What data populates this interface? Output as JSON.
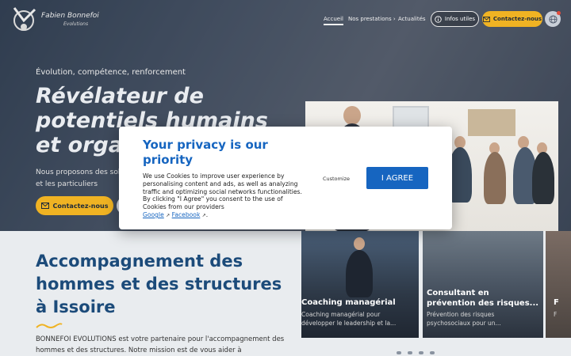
{
  "nav": {
    "logo_name": "Fabien Bonnefoi",
    "logo_sub": "Evolutions",
    "links": [
      "Accueil",
      "Nos prestations",
      "Actualités"
    ],
    "nos_prestations_chevron": "›",
    "info_button": "Infos utiles",
    "contact_button": "Contactez-nous",
    "globe_icon": "globe-icon"
  },
  "hero": {
    "eyebrow": "Évolution, compétence, renforcement",
    "title": "Révélateur de potentiels humains et organisationnels",
    "description": "Nous proposons des solutions d'accompagnement aux entreprises et les particuliers",
    "contact_button": "Contactez-nous"
  },
  "lower": {
    "title": "Accompagnement des hommes et des structures à Issoire",
    "text": "BONNEFOI EVOLUTIONS est votre partenaire pour l'accompagnement des hommes et des structures. Notre mission est de vous aider à"
  },
  "cards": [
    {
      "title": "Coaching managérial",
      "sub1": "Coaching managérial pour",
      "sub2": "développer le leadership et la..."
    },
    {
      "title": "Consultant en",
      "title2": "prévention des risques...",
      "sub1": "Prévention des risques",
      "sub2": "psychosociaux pour un..."
    },
    {
      "title": "F",
      "sub1": "F",
      "sub2": ""
    }
  ],
  "cookie_modal": {
    "title": "Your privacy is our priority",
    "body": "We use Cookies to improve user experience by personalising content and ads, as well as analyzing traffic and optimizing social networks functionalities. By clicking \"I Agree\" you consent to the use of Cookies from our providers",
    "link_google": "Google",
    "link_facebook": "Facebook",
    "link_sep": " ",
    "link_end": ".",
    "customize": "Customize",
    "agree": "I AGREE"
  },
  "colors": {
    "accent": "#f0b323",
    "brand_blue": "#1665c0",
    "title_blue": "#1c4b7a"
  }
}
